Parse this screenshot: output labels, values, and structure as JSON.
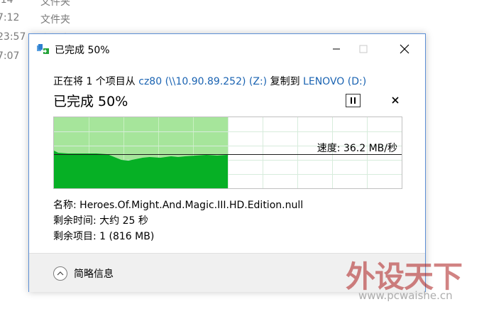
{
  "background": {
    "rows": [
      {
        "time": ":14",
        "kind": "文件夹"
      },
      {
        "time": "7:12",
        "kind": "文件夹"
      },
      {
        "time": "23:57",
        "kind": "文件夹"
      },
      {
        "time": "7:07",
        "kind": ""
      }
    ]
  },
  "dialog": {
    "title": "已完成 50%",
    "copy_prefix": "正在将 1 个项目从 ",
    "source_link": "cz80 (\\\\10.90.89.252) (Z:)",
    "copy_middle": " 复制到 ",
    "dest_link": "LENOVO (D:)",
    "status": "已完成 50%",
    "progress_percent": 50,
    "speed_text": "速度: 36.2 MB/秒",
    "name_label": "名称: ",
    "name_value": "Heroes.Of.Might.And.Magic.III.HD.Edition.null",
    "time_label": "剩余时间: ",
    "time_value": "大约 25 秒",
    "items_label": "剩余项目: ",
    "items_value": "1 (816 MB)",
    "details_label": "简略信息"
  },
  "colors": {
    "accent_link": "#1a63b2",
    "progress_light": "#a6e59b",
    "progress_dark": "#06b025",
    "border": "#5c8fd6"
  },
  "watermark": {
    "brand": "外设天下",
    "url": "www.pcwaishe.cn"
  }
}
